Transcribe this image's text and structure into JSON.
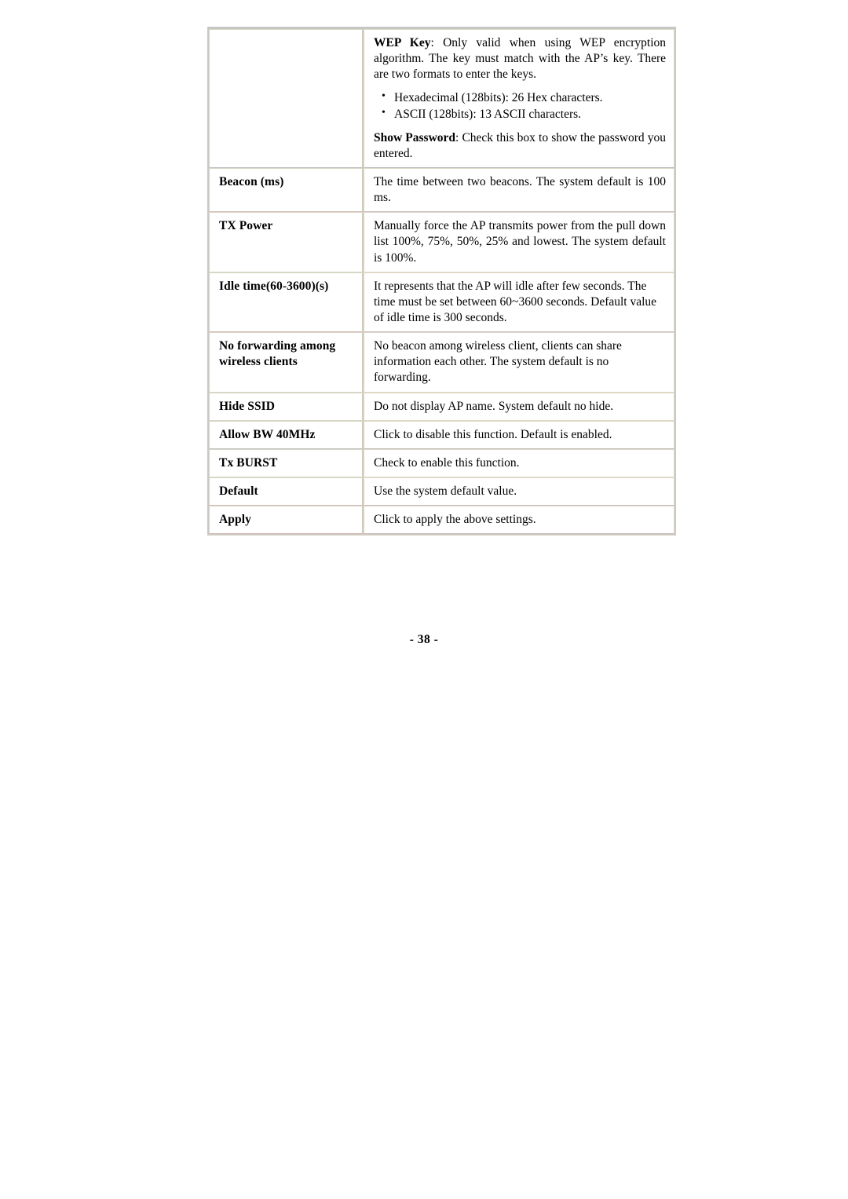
{
  "document": {
    "page_number": "- 38 -"
  },
  "table": {
    "rows": [
      {
        "term": "",
        "tint": "gray",
        "blocks": [
          {
            "kind": "paragraph",
            "lead": "WEP Key",
            "text": ": Only valid when using WEP encryption algorithm. The key must match with the AP’s key. There are two formats to enter the keys."
          },
          {
            "kind": "bullets",
            "items": [
              "Hexadecimal (128bits): 26 Hex characters.",
              "ASCII (128bits): 13 ASCII characters."
            ]
          },
          {
            "kind": "paragraph",
            "lead": "Show Password",
            "text": ": Check this box to show the password you entered."
          }
        ]
      },
      {
        "term": "Beacon (ms)",
        "tint": "pink",
        "blocks": [
          {
            "kind": "paragraph",
            "lead": "",
            "text": "The time between two beacons. The system default is 100 ms."
          }
        ]
      },
      {
        "term": "TX Power",
        "tint": "plain",
        "blocks": [
          {
            "kind": "paragraph",
            "lead": "",
            "text": "Manually force the AP transmits power from the pull down list 100%, 75%, 50%, 25% and lowest. The system default is 100%."
          }
        ]
      },
      {
        "term": "Idle time(60-3600)(s)",
        "tint": "pink",
        "blocks": [
          {
            "kind": "paragraph-left",
            "lead": "",
            "text": "It represents that the AP will idle after few seconds. The time must be set between 60~3600 seconds. Default value of idle time is 300 seconds."
          }
        ]
      },
      {
        "term": "No forwarding among wireless clients",
        "tint": "plain",
        "blocks": [
          {
            "kind": "paragraph-left",
            "lead": "",
            "text": "No beacon among wireless client, clients can share information each other. The system default is no forwarding."
          }
        ]
      },
      {
        "term": "Hide SSID",
        "tint": "plain",
        "blocks": [
          {
            "kind": "paragraph-left",
            "lead": "",
            "text": "Do not display AP name. System default no hide."
          }
        ]
      },
      {
        "term": "Allow BW 40MHz",
        "tint": "gray",
        "blocks": [
          {
            "kind": "paragraph-left",
            "lead": "",
            "text": "Click to disable this function. Default is enabled."
          }
        ]
      },
      {
        "term": "Tx BURST",
        "tint": "plain",
        "blocks": [
          {
            "kind": "paragraph-left",
            "lead": "",
            "text": "Check to enable this function."
          }
        ]
      },
      {
        "term": "Default",
        "tint": "pink",
        "blocks": [
          {
            "kind": "paragraph-left",
            "lead": "",
            "text": "Use the system default value."
          }
        ]
      },
      {
        "term": "Apply",
        "tint": "pink",
        "blocks": [
          {
            "kind": "paragraph-left",
            "lead": "",
            "text": "Click to apply the above settings."
          }
        ]
      }
    ]
  }
}
